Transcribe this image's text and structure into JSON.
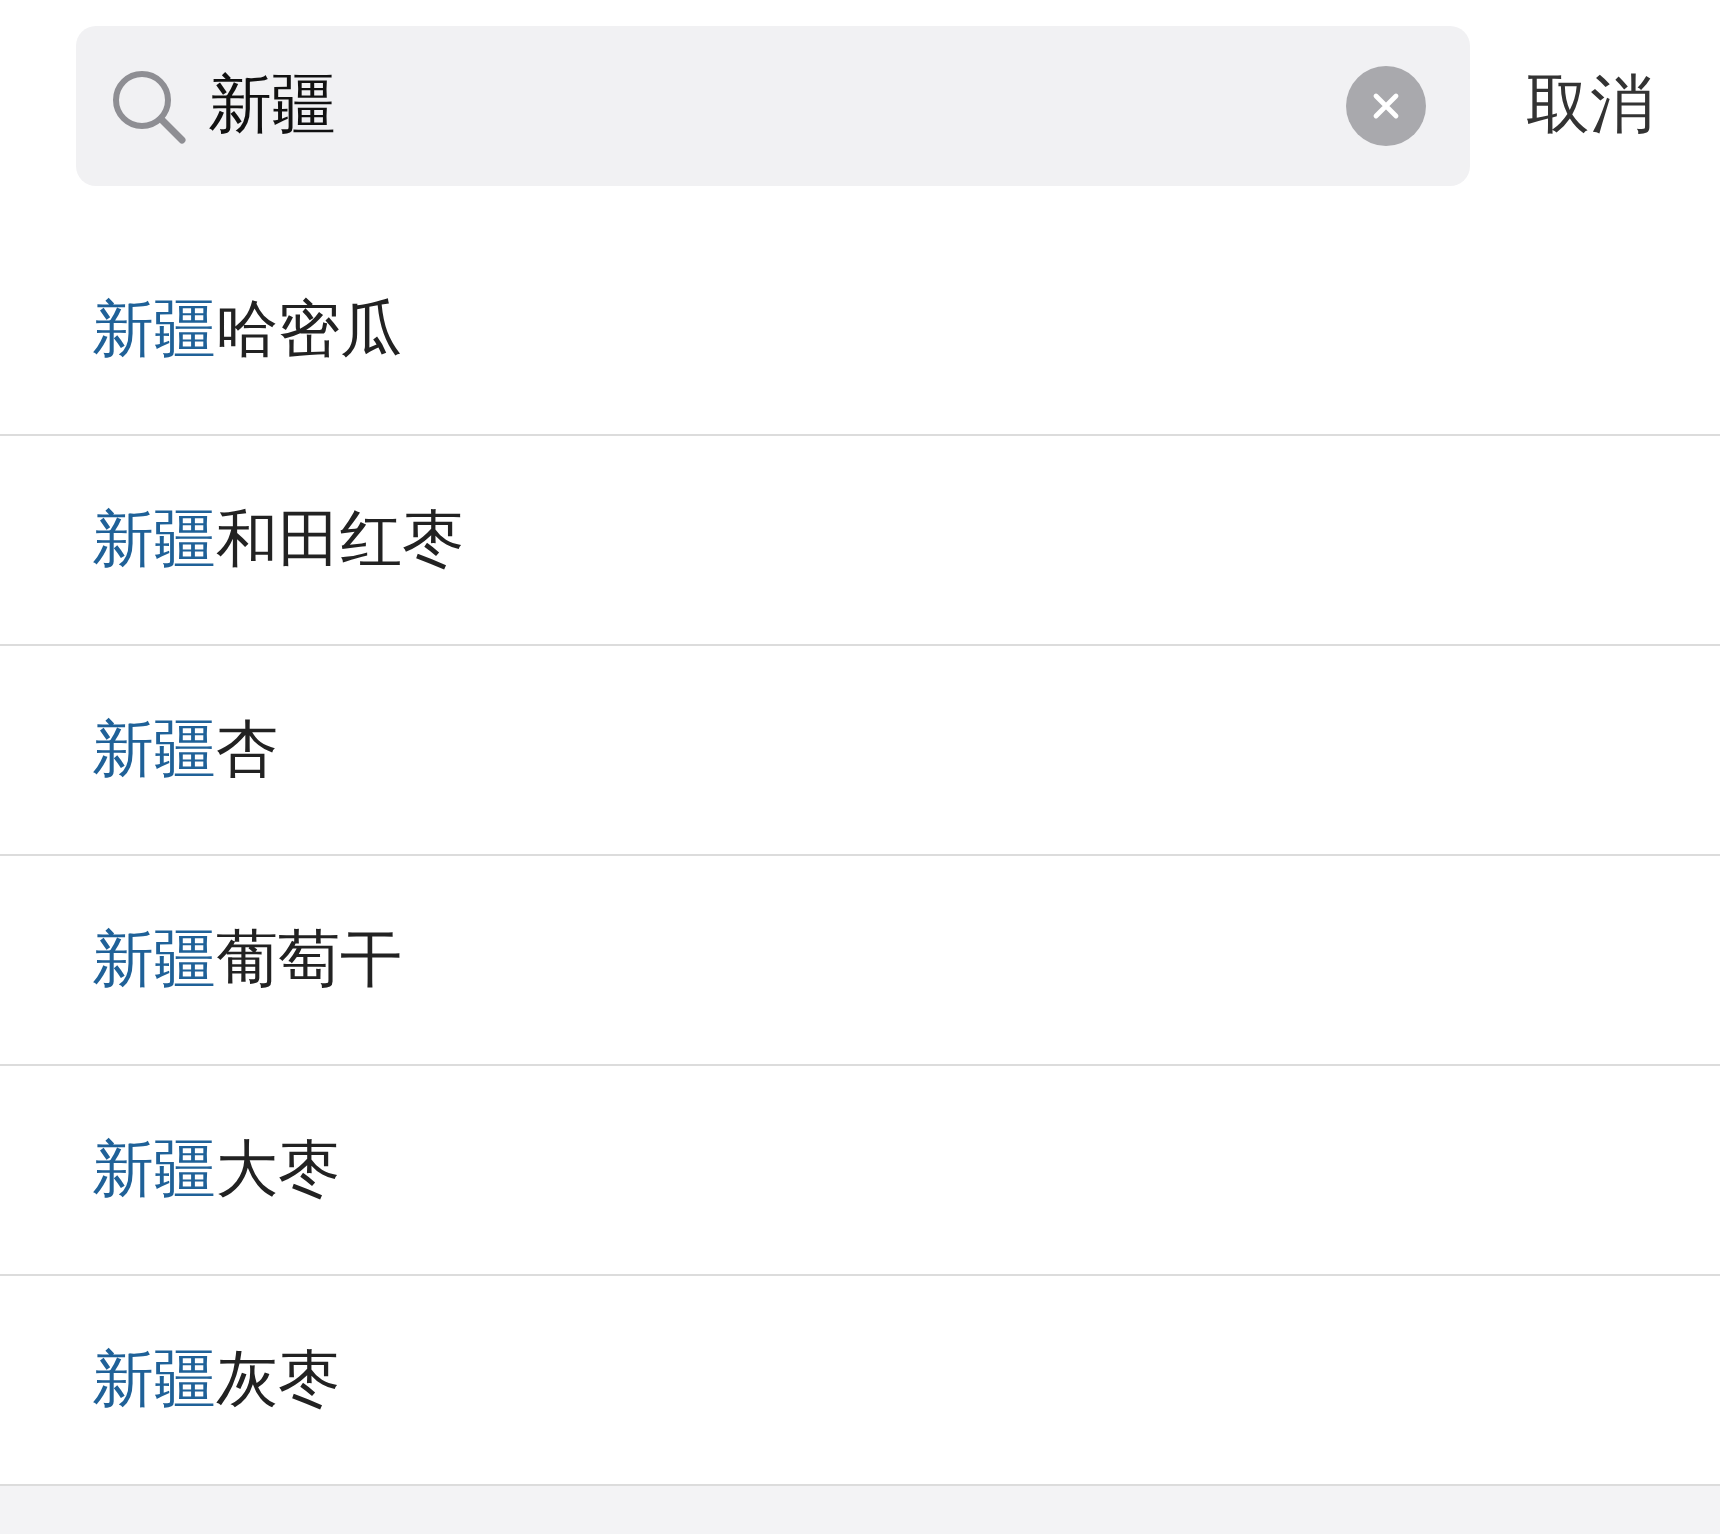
{
  "search": {
    "value": "新疆"
  },
  "cancel_label": "取消",
  "suggestions": [
    {
      "match": "新疆",
      "rest": "哈密瓜"
    },
    {
      "match": "新疆",
      "rest": "和田红枣"
    },
    {
      "match": "新疆",
      "rest": "杏"
    },
    {
      "match": "新疆",
      "rest": "葡萄干"
    },
    {
      "match": "新疆",
      "rest": "大枣"
    },
    {
      "match": "新疆",
      "rest": "灰枣"
    }
  ]
}
